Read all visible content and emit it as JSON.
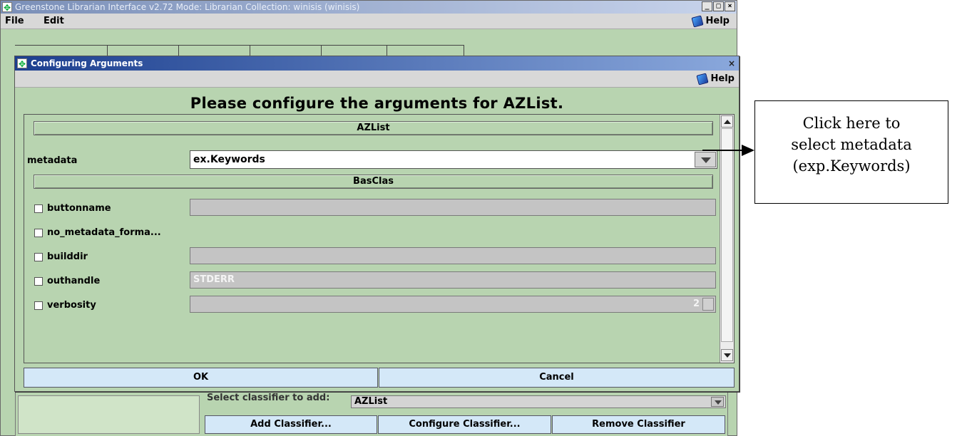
{
  "main_window": {
    "title": "Greenstone Librarian Interface v2.72  Mode: Librarian  Collection: winisis (winisis)",
    "window_buttons": [
      "_",
      "□",
      "×"
    ],
    "menu": [
      "File",
      "Edit"
    ],
    "help_label": "Help"
  },
  "dialog": {
    "title": "Configuring Arguments",
    "close_glyph": "×",
    "help_label": "Help",
    "heading": "Please configure the arguments for AZList.",
    "section_azlist": "AZList",
    "metadata_label": "metadata",
    "metadata_value": "ex.Keywords",
    "section_basclas": "BasClas",
    "args": [
      {
        "label": "buttonname",
        "value": "",
        "has_field": true
      },
      {
        "label": "no_metadata_forma...",
        "value": "",
        "has_field": false
      },
      {
        "label": "builddir",
        "value": "",
        "has_field": true
      },
      {
        "label": "outhandle",
        "value": "STDERR",
        "has_field": true
      },
      {
        "label": "verbosity",
        "value": "2",
        "has_field": true,
        "spinner": true
      }
    ],
    "ok_label": "OK",
    "cancel_label": "Cancel"
  },
  "classifier_area": {
    "select_label": "Select classifier to add:",
    "select_value": "AZList",
    "add_label": "Add Classifier...",
    "configure_label": "Configure Classifier...",
    "remove_label": "Remove Classifier"
  },
  "callout": {
    "lines": [
      "Click here to",
      "select metadata",
      "(exp.Keywords)"
    ]
  },
  "colors": {
    "panel_green": "#b8d4b0",
    "button_blue": "#d4e8f8",
    "dialog_titlebar": "#1c3f8f"
  },
  "icons": [
    "app-icon",
    "help-icon",
    "checkbox-icon",
    "dropdown-arrow-icon",
    "scroll-up-icon",
    "scroll-down-icon",
    "arrow-icon"
  ]
}
